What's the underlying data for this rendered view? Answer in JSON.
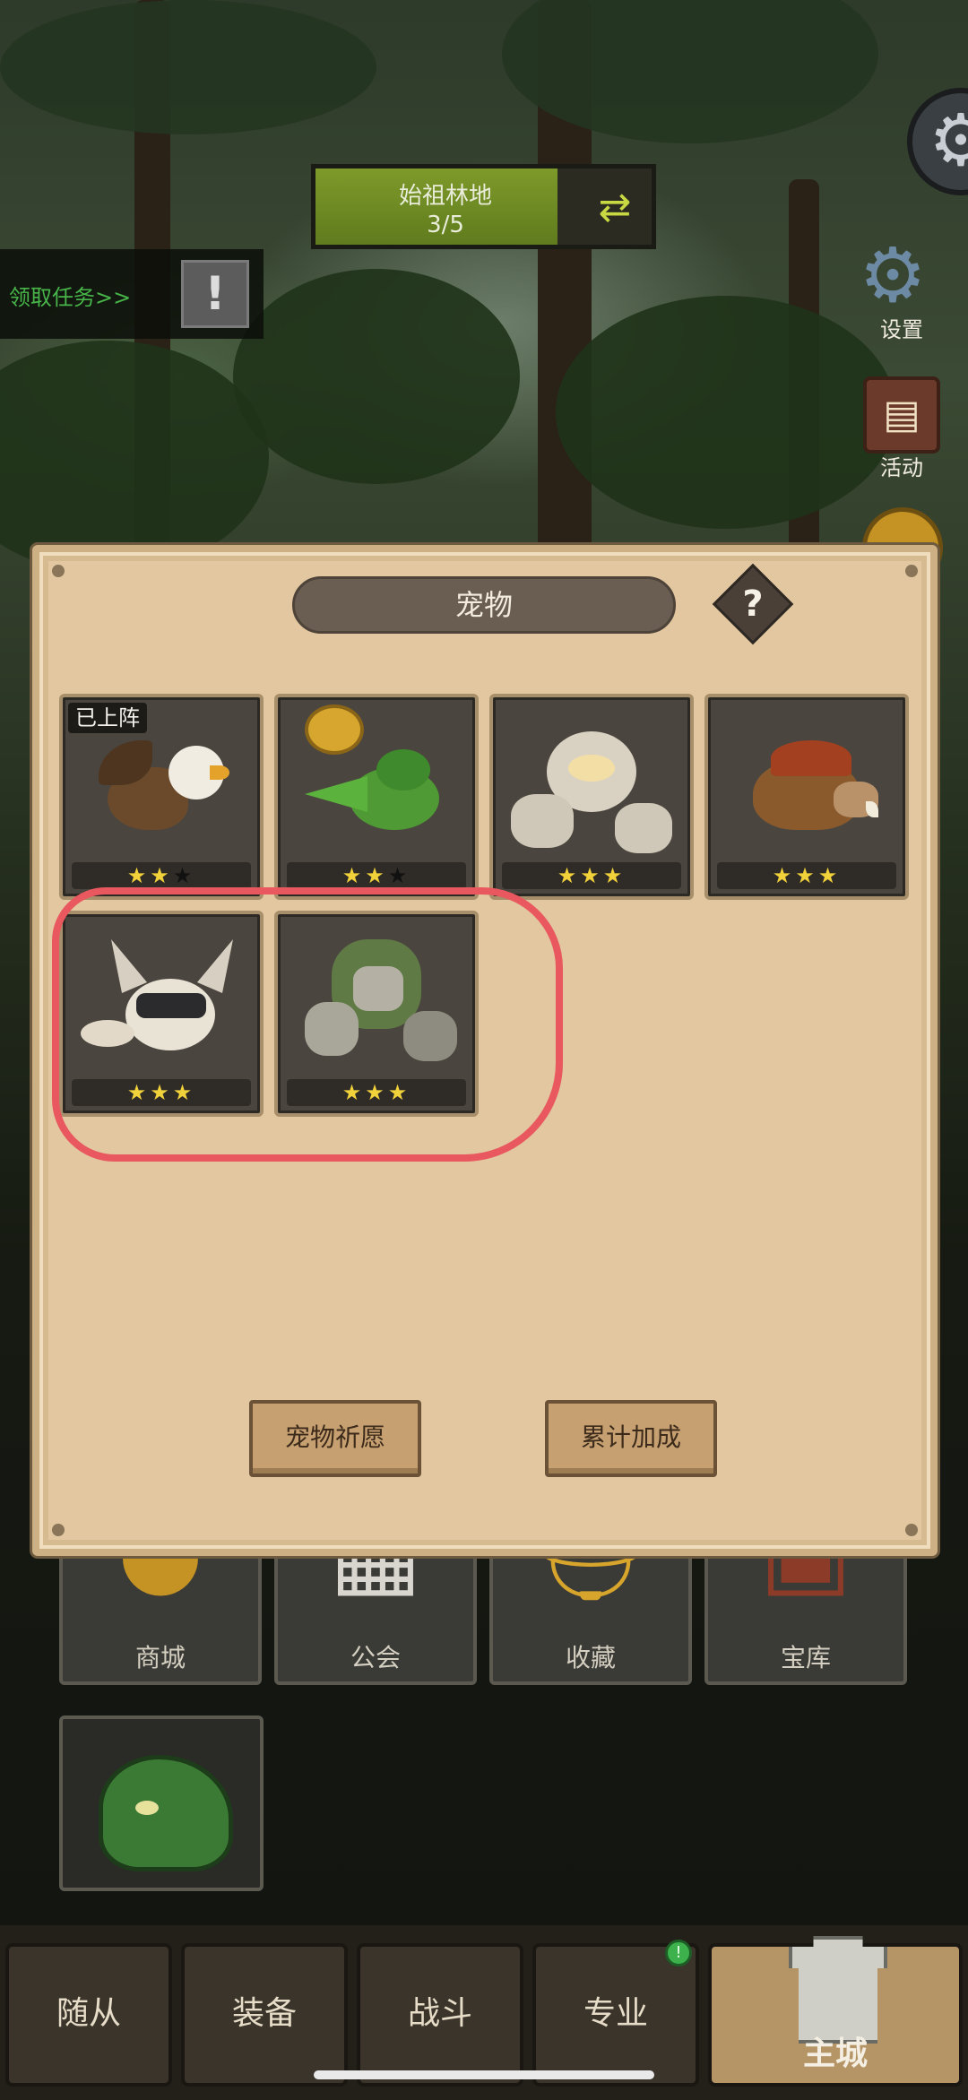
{
  "stage": {
    "name": "始祖林地",
    "progress": "3/5",
    "fill_fraction": 0.72
  },
  "task": {
    "label": "领取任务>>",
    "alert": "!"
  },
  "side_menu": {
    "settings_label": "设置",
    "activity_label": "活动"
  },
  "menu_grid": [
    {
      "label": "商城",
      "icon": "coin-icon"
    },
    {
      "label": "公会",
      "icon": "guild-hall-icon"
    },
    {
      "label": "收藏",
      "icon": "helmet-icon"
    },
    {
      "label": "宝库",
      "icon": "vault-icon"
    }
  ],
  "pet_dialog": {
    "title": "宠物",
    "help": "?",
    "deployed_tag": "已上阵",
    "pets": [
      {
        "name": "griffin",
        "stars": 2,
        "max_stars": 3,
        "deployed": true
      },
      {
        "name": "green-dragon",
        "stars": 2,
        "max_stars": 3,
        "deployed": false
      },
      {
        "name": "stone-spirit",
        "stars": 3,
        "max_stars": 3,
        "deployed": false
      },
      {
        "name": "boar",
        "stars": 3,
        "max_stars": 3,
        "deployed": false
      },
      {
        "name": "fennec-ninja",
        "stars": 3,
        "max_stars": 3,
        "deployed": false
      },
      {
        "name": "moss-golem",
        "stars": 3,
        "max_stars": 3,
        "deployed": false
      }
    ],
    "buttons": {
      "wish": "宠物祈愿",
      "bonus": "累计加成"
    }
  },
  "bottom_nav": {
    "tabs": [
      "随从",
      "装备",
      "战斗",
      "专业"
    ],
    "home": "主城",
    "active": "主城"
  },
  "colors": {
    "highlight": "#e8585e",
    "dialog_bg": "#e2c7a0",
    "star": "#f2d23a"
  }
}
